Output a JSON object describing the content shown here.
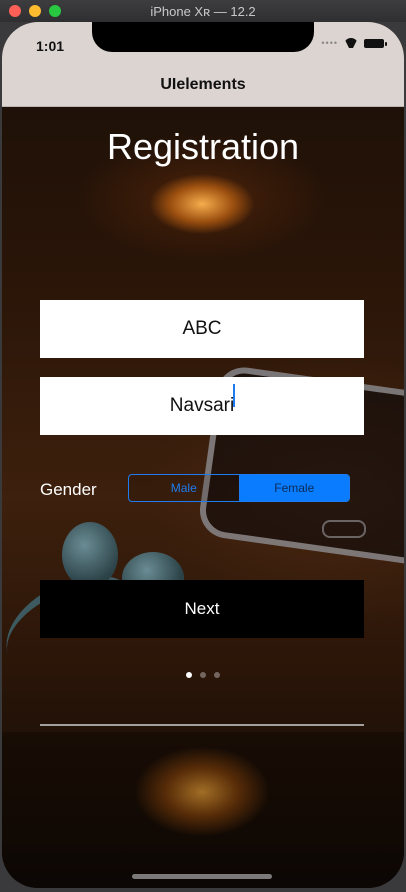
{
  "window": {
    "title": "iPhone Xʀ — 12.2"
  },
  "status_bar": {
    "time": "1:01"
  },
  "nav": {
    "title": "UIelements"
  },
  "page": {
    "heading": "Registration"
  },
  "form": {
    "name_value": "ABC",
    "city_value": "Navsari",
    "gender_label": "Gender",
    "gender_options": [
      "Male",
      "Female"
    ],
    "gender_selected": "Female",
    "next_label": "Next"
  },
  "pager": {
    "count": 3,
    "current": 1
  },
  "colors": {
    "accent": "#0a7cff",
    "button_bg": "#000000"
  }
}
